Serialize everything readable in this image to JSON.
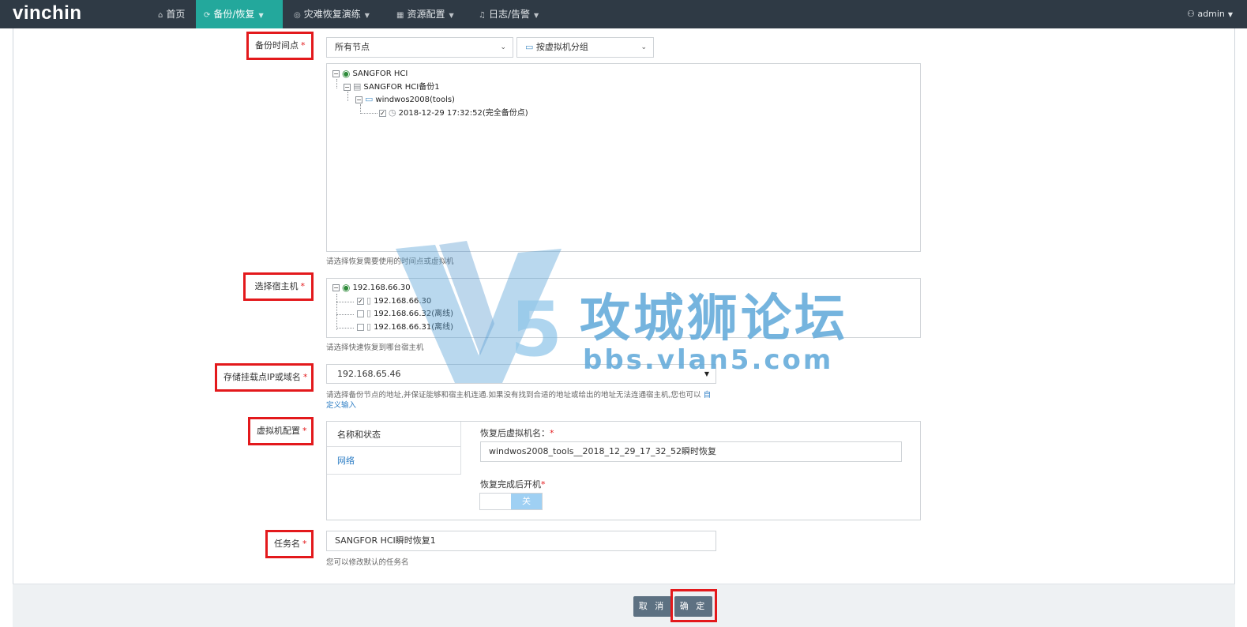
{
  "header": {
    "logo": "vinchin",
    "nav": [
      {
        "label": "首页",
        "icon": "home-icon"
      },
      {
        "label": "备份/恢复",
        "icon": "refresh-icon",
        "active": true
      },
      {
        "label": "灾难恢复演练",
        "icon": "camera-icon"
      },
      {
        "label": "资源配置",
        "icon": "grid-icon"
      },
      {
        "label": "日志/告警",
        "icon": "bell-icon"
      }
    ],
    "user": "admin",
    "active_color": "#23a89c"
  },
  "backup_point": {
    "label": "备份时间点",
    "node_select": "所有节点",
    "group_select": "按虚拟机分组",
    "tree": {
      "root": "SANGFOR HCI",
      "child": "SANGFOR HCI备份1",
      "vm": "windwos2008(tools)",
      "point": "2018-12-29 17:32:52(完全备份点)"
    },
    "hint": "请选择恢复需要使用的时间点或虚拟机"
  },
  "host": {
    "label": "选择宿主机",
    "root": "192.168.66.30",
    "items": [
      {
        "label": "192.168.66.30",
        "checked": true
      },
      {
        "label": "192.168.66.32(离线)",
        "checked": false
      },
      {
        "label": "192.168.66.31(离线)",
        "checked": false
      }
    ],
    "hint": "请选择快速恢复到哪台宿主机"
  },
  "storage": {
    "label": "存储挂载点IP或域名",
    "value": "192.168.65.46",
    "hint": "请选择备份节点的地址,并保证能够和宿主机连通.如果没有找到合适的地址或给出的地址无法连通宿主机,您也可以",
    "link_1": "自",
    "link_2": "定义输入"
  },
  "vm_config": {
    "label": "虚拟机配置",
    "tabs": [
      "名称和状态",
      "网络"
    ],
    "name_label": "恢复后虚拟机名：",
    "name_value": "windwos2008_tools__2018_12_29_17_32_52瞬时恢复",
    "power_label": "恢复完成后开机",
    "power_state": "关"
  },
  "task": {
    "label": "任务名",
    "value": "SANGFOR HCI瞬时恢复1",
    "hint": "您可以修改默认的任务名"
  },
  "required_mark": "*",
  "actions": {
    "cancel": "取 消",
    "confirm": "确 定"
  },
  "watermark": {
    "title": "攻城狮论坛",
    "url": "bbs.vlan5.com",
    "badge": "5"
  }
}
